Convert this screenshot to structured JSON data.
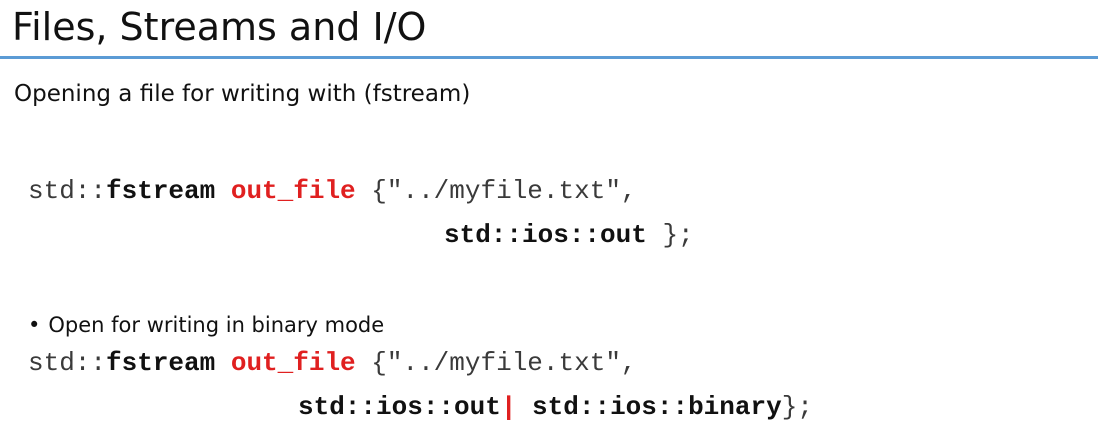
{
  "slide": {
    "title": "Files, Streams and I/O",
    "subtitle": "Opening a file for writing with (fstream)",
    "bullet_text": "Open for writing in binary mode",
    "bullet_marker": "•"
  },
  "code1": {
    "line1": {
      "ns": "std::",
      "type": "fstream",
      "space": " ",
      "var": "out_file",
      "rest": " {\"../myfile.txt\","
    },
    "line2": {
      "mode": "std::ios::out",
      "tail": " };"
    }
  },
  "code2": {
    "line1": {
      "ns": "std::",
      "type": "fstream",
      "space": " ",
      "var": "out_file",
      "rest": " {\"../myfile.txt\","
    },
    "line2": {
      "mode1": "std::ios::out",
      "pipe": "|",
      "mode2": " std::ios::binary",
      "tail": "};"
    }
  },
  "colors": {
    "accent_rule": "#5b9bd5",
    "highlight": "#e02020"
  }
}
